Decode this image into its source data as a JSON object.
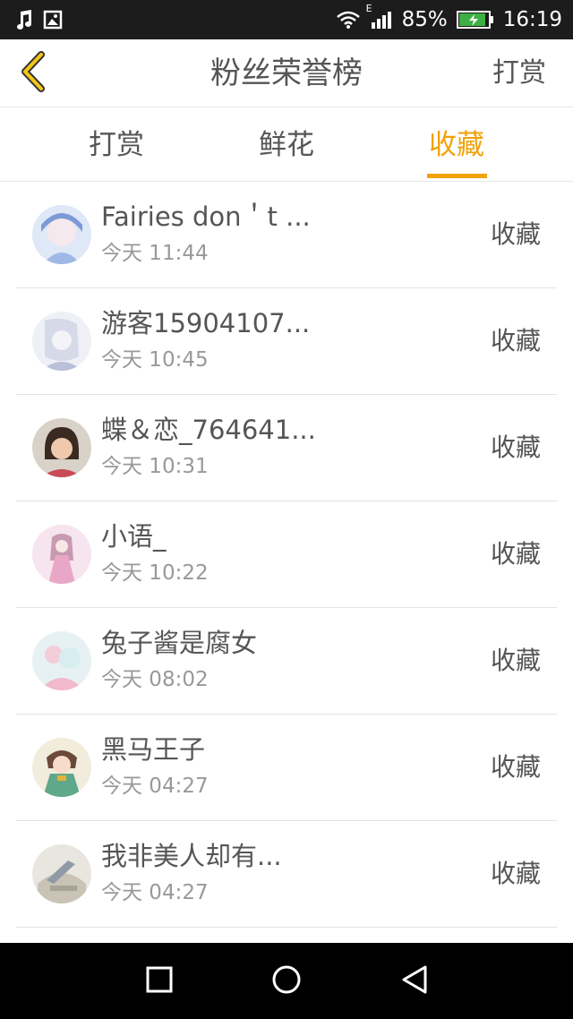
{
  "status_bar": {
    "music_icon": "music-note-icon",
    "image_icon": "image-icon",
    "wifi_icon": "wifi-icon",
    "signal_icon": "signal-icon",
    "network_type": "E",
    "battery_percent": "85%",
    "battery_icon": "battery-charging-icon",
    "time": "16:19"
  },
  "header": {
    "back_icon": "chevron-left-icon",
    "title": "粉丝荣誉榜",
    "action_label": "打赏"
  },
  "tabs": [
    {
      "label": "打赏",
      "active": false
    },
    {
      "label": "鲜花",
      "active": false
    },
    {
      "label": "收藏",
      "active": true
    }
  ],
  "list": [
    {
      "name": "Fairies don＇t ...",
      "time": "今天 11:44",
      "action": "收藏"
    },
    {
      "name": "游客15904107...",
      "time": "今天 10:45",
      "action": "收藏"
    },
    {
      "name": "蝶＆恋_764641...",
      "time": "今天 10:31",
      "action": "收藏"
    },
    {
      "name": "小语_",
      "time": "今天 10:22",
      "action": "收藏"
    },
    {
      "name": "兔子酱是腐女",
      "time": "今天 08:02",
      "action": "收藏"
    },
    {
      "name": "黑马王子",
      "time": "今天 04:27",
      "action": "收藏"
    },
    {
      "name": "我非美人却有...",
      "time": "今天 04:27",
      "action": "收藏"
    }
  ],
  "nav_bar": {
    "recents_icon": "square-icon",
    "home_icon": "circle-icon",
    "back_icon": "triangle-back-icon"
  },
  "colors": {
    "accent": "#f0a20a",
    "text": "#555555",
    "subtext": "#999999",
    "divider": "#e3e3e3",
    "status_bar_bg": "#1c1c1c",
    "nav_bar_bg": "#000000"
  }
}
